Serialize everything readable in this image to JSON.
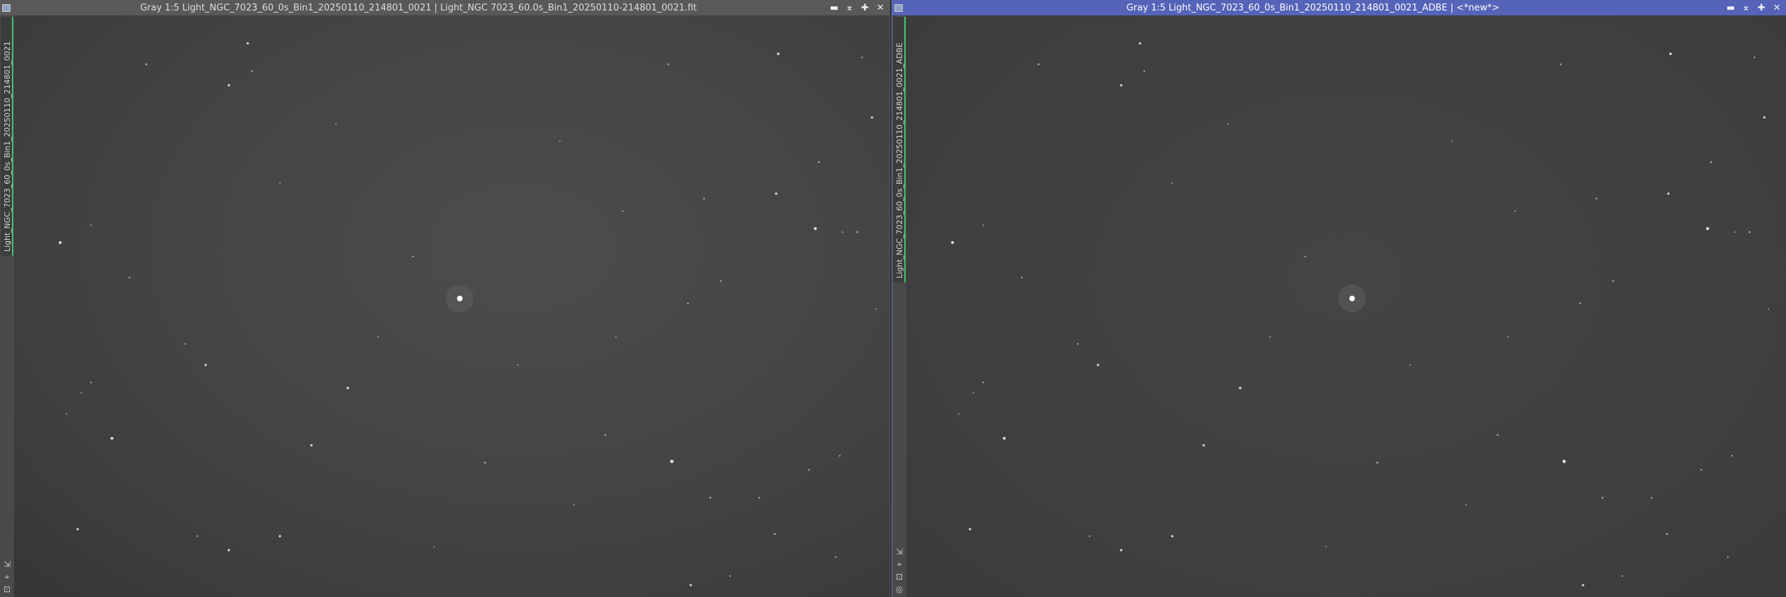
{
  "left_window": {
    "title": "Gray 1:5 Light_NGC_7023_60_0s_Bin1_20250110_214801_0021 | Light_NGC 7023_60.0s_Bin1_20250110-214801_0021.fit",
    "side_tab": "Light_NGC_7023_60_0s_Bin1_20250110_214801_0021",
    "controls": {
      "minimize": "▬",
      "shade": "⌅",
      "maximize": "✚",
      "close": "✕"
    },
    "icons": [
      "arrow-icon",
      "pin-icon",
      "lock-icon"
    ]
  },
  "right_window": {
    "title": "Gray 1:5 Light_NGC_7023_60_0s_Bin1_20250110_214801_0021_ADBE | <*new*>",
    "side_tab": "Light_NGC_7023_60_0s_Bin1_20250110_214801_0021_ADBE",
    "controls": {
      "minimize": "▬",
      "shade": "⌅",
      "maximize": "✚",
      "close": "✕"
    },
    "icons": [
      "arrow-icon",
      "pin-icon",
      "lock-icon",
      "circle-icon"
    ]
  },
  "colors": {
    "inactive_titlebar": "#595959",
    "active_titlebar": "#5563b8",
    "tab_accent": "#3fc26a"
  }
}
